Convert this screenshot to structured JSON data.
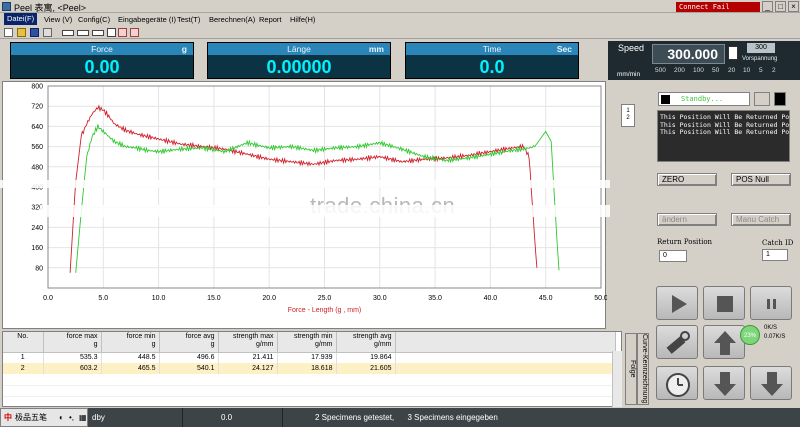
{
  "window": {
    "title": "Peel 表寓, <Peel>",
    "connection_status": "Connect Fail"
  },
  "menu": {
    "items": [
      "Datei(F)",
      "View (V)",
      "Config(C)",
      "Eingabegeräte (I)",
      "Test(T)",
      "Berechnen(A)",
      "Report",
      "Hilfe(H)"
    ]
  },
  "panels": {
    "force": {
      "label": "Force",
      "unit": "g",
      "value": "0.00"
    },
    "laenge": {
      "label": "Länge",
      "unit": "mm",
      "value": "0.00000"
    },
    "time": {
      "label": "Time",
      "unit": "Sec",
      "value": "0.0"
    }
  },
  "speed": {
    "label": "Speed",
    "unit": "mm/min",
    "value": "300.000",
    "preset": "300",
    "vorspannung_label": "Vorspannung",
    "ticks": [
      "500",
      "200",
      "100",
      "50",
      "20",
      "10",
      "5",
      "2"
    ]
  },
  "chart_data": {
    "type": "line",
    "xlabel": "Force - Length    (g , mm)",
    "ylabel": "",
    "xlim": [
      0,
      50
    ],
    "ylim": [
      0,
      800
    ],
    "x_ticks": [
      "0.0",
      "5.0",
      "10.0",
      "15.0",
      "20.0",
      "25.0",
      "30.0",
      "35.0",
      "40.0",
      "45.0",
      "50.0"
    ],
    "y_ticks": [
      "80",
      "160",
      "240",
      "320",
      "400",
      "480",
      "560",
      "640",
      "720",
      "800"
    ],
    "series": [
      {
        "color": "#d0202a",
        "x": [
          2.0,
          2.5,
          3.0,
          3.5,
          4.0,
          4.5,
          5.0,
          5.5,
          6.0,
          7.0,
          8.0,
          9.0,
          10.0,
          12.0,
          14.0,
          16.0,
          18.0,
          20.0,
          22.0,
          24.0,
          26.0,
          28.0,
          30.0,
          32.0,
          34.0,
          36.0,
          38.0,
          40.0,
          42.0,
          43.0,
          43.5,
          44.0,
          44.2
        ],
        "y": [
          60,
          420,
          600,
          650,
          690,
          715,
          705,
          680,
          650,
          625,
          610,
          600,
          590,
          570,
          560,
          550,
          530,
          510,
          500,
          490,
          505,
          510,
          520,
          500,
          510,
          515,
          525,
          540,
          555,
          560,
          520,
          200,
          80
        ]
      },
      {
        "color": "#2ec82e",
        "x": [
          2.5,
          3.0,
          3.5,
          4.0,
          4.5,
          5.0,
          6.0,
          7.0,
          8.0,
          9.0,
          10.0,
          12.0,
          14.0,
          16.0,
          18.0,
          20.0,
          22.0,
          24.0,
          26.0,
          28.0,
          30.0,
          32.0,
          34.0,
          36.0,
          38.0,
          40.0,
          42.0,
          43.0,
          44.0,
          45.0,
          45.5,
          46.0,
          46.2
        ],
        "y": [
          60,
          300,
          520,
          600,
          640,
          620,
          580,
          560,
          555,
          545,
          540,
          550,
          555,
          540,
          575,
          555,
          560,
          545,
          555,
          560,
          575,
          550,
          520,
          505,
          515,
          530,
          545,
          550,
          560,
          620,
          580,
          200,
          70
        ]
      }
    ]
  },
  "right": {
    "status_text": "Standby...",
    "messages": [
      "This Position Will Be Returned Positi",
      "This Position Will Be Returned Positi",
      "This Position Will Be Returned Positi"
    ],
    "zero_label": "ZERO",
    "posnull_label": "POS Null",
    "aendern_label": "ändern",
    "manucatch_label": "Manu Catch",
    "return_position_label": "Return Position",
    "return_position_value": "0",
    "catch_id_label": "Catch ID",
    "catch_id_value": "1"
  },
  "speed_indicator": {
    "percent": "23%",
    "up": "0K/S",
    "down": "0.07K/S"
  },
  "table": {
    "headers": [
      {
        "l1": "No.",
        "l2": ""
      },
      {
        "l1": "force max",
        "l2": "g"
      },
      {
        "l1": "force min",
        "l2": "g"
      },
      {
        "l1": "force avg",
        "l2": "g"
      },
      {
        "l1": "strength max",
        "l2": "g/mm"
      },
      {
        "l1": "strength min",
        "l2": "g/mm"
      },
      {
        "l1": "strength avg",
        "l2": "g/mm"
      }
    ],
    "rows": [
      [
        "1",
        "535.3",
        "448.5",
        "496.6",
        "21.411",
        "17.939",
        "19.864"
      ],
      [
        "2",
        "603.2",
        "465.5",
        "540.1",
        "24.127",
        "18.618",
        "21.605"
      ]
    ]
  },
  "side_tabs": [
    "Folge",
    "Curve-Kennzeichnung"
  ],
  "statusbar": {
    "ime_label": "极品五笔",
    "mode": "dby",
    "value": "0.0",
    "tested": "2  Specimens getestet,",
    "entered": "3  Specimens eingegeben"
  }
}
